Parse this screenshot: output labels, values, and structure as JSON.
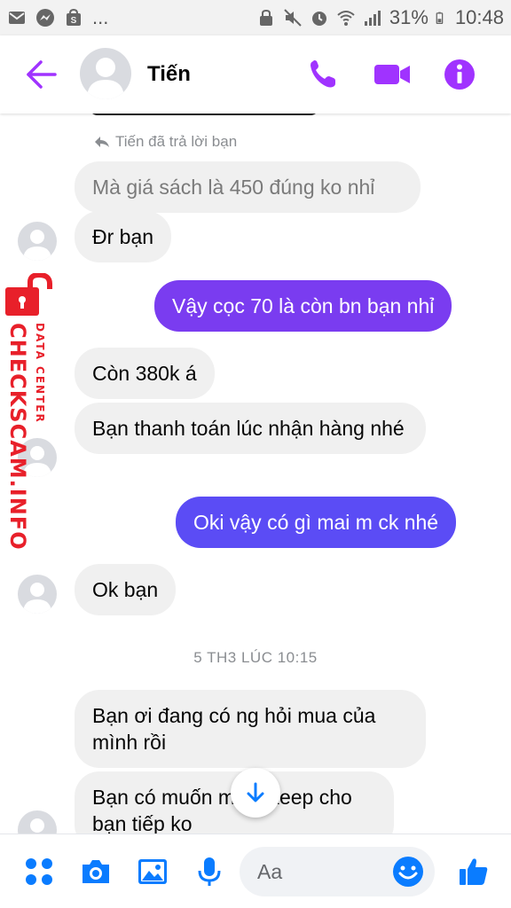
{
  "status_bar": {
    "battery": "31%",
    "time": "10:48",
    "overflow": "..."
  },
  "header": {
    "contact_name": "Tiến"
  },
  "chat": {
    "reply_note": "Tiến đã trả lời bạn",
    "messages": [
      {
        "text": "Mà giá sách là 450 đúng ko nhỉ"
      },
      {
        "text": "Đr bạn"
      },
      {
        "text": "Vậy cọc 70 là còn bn bạn nhỉ"
      },
      {
        "text": "Còn 380k á"
      },
      {
        "text": "Bạn thanh toán lúc nhận hàng nhé"
      },
      {
        "text": "Oki vậy có gì mai m ck nhé"
      },
      {
        "text": "Ok bạn"
      },
      {
        "text": "Bạn ơi đang có ng hỏi mua của mình rồi"
      },
      {
        "text": "Bạn có muốn mình keep cho bạn tiếp ko"
      }
    ],
    "time_separator": "5 TH3 LÚC 10:15"
  },
  "watermark": {
    "main": "CHECKSCAM.INFO",
    "sub": "DATA CENTER"
  },
  "composer": {
    "placeholder": "Aa"
  },
  "colors": {
    "accent": "#a033ff",
    "out_bubble_top": "#7a3cf0",
    "out_bubble_low": "#5b4cf5",
    "incoming_bubble": "#f0f0f0",
    "composer_icon": "#0a7cff",
    "watermark": "#e8202a"
  },
  "icons": [
    "back-arrow-icon",
    "phone-icon",
    "video-icon",
    "info-icon",
    "reply-icon",
    "scroll-down-icon",
    "menu-grid-icon",
    "camera-icon",
    "gallery-icon",
    "mic-icon",
    "emoji-icon",
    "like-icon",
    "lock-icon"
  ]
}
